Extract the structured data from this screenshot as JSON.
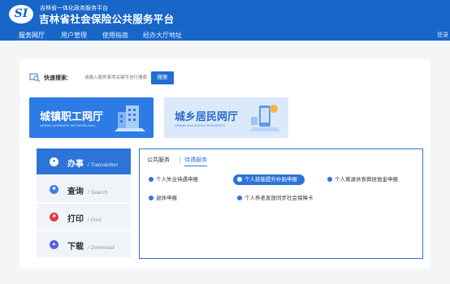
{
  "header": {
    "logo_text": "SI",
    "org_small": "吉林省一体化政务服务平台",
    "title": "吉林省社会保险公共服务平台",
    "nav": [
      "服务网厅",
      "用户管理",
      "使用指南",
      "经办大厅地址"
    ],
    "right_text": "登录"
  },
  "search": {
    "label": "快速搜索:",
    "placeholder": "请输入服务事项关键字进行搜索",
    "button": "搜索"
  },
  "banners": [
    {
      "title": "城镇职工网厅",
      "subtitle": "URBAN WORKERS' NETWORK HALL"
    },
    {
      "title": "城乡居民网厅",
      "subtitle": "URBAN AND RURAL RESIDENTS"
    }
  ],
  "menu": [
    {
      "label": "办事",
      "en": "/ Transaction"
    },
    {
      "label": "查询",
      "en": "/ Search"
    },
    {
      "label": "打印",
      "en": "/ Print"
    },
    {
      "label": "下载",
      "en": "/ Download"
    }
  ],
  "tabs": [
    "公共服务",
    "待遇服务"
  ],
  "services": [
    "个人失业待遇申报",
    "个人技能提升补贴申报",
    "个人离退休丧葬抚恤金申报",
    "退休申报",
    "个人养老发放同步社会保障卡"
  ],
  "colors": {
    "brand": "#1766c8",
    "accent": "#2d74d9"
  }
}
